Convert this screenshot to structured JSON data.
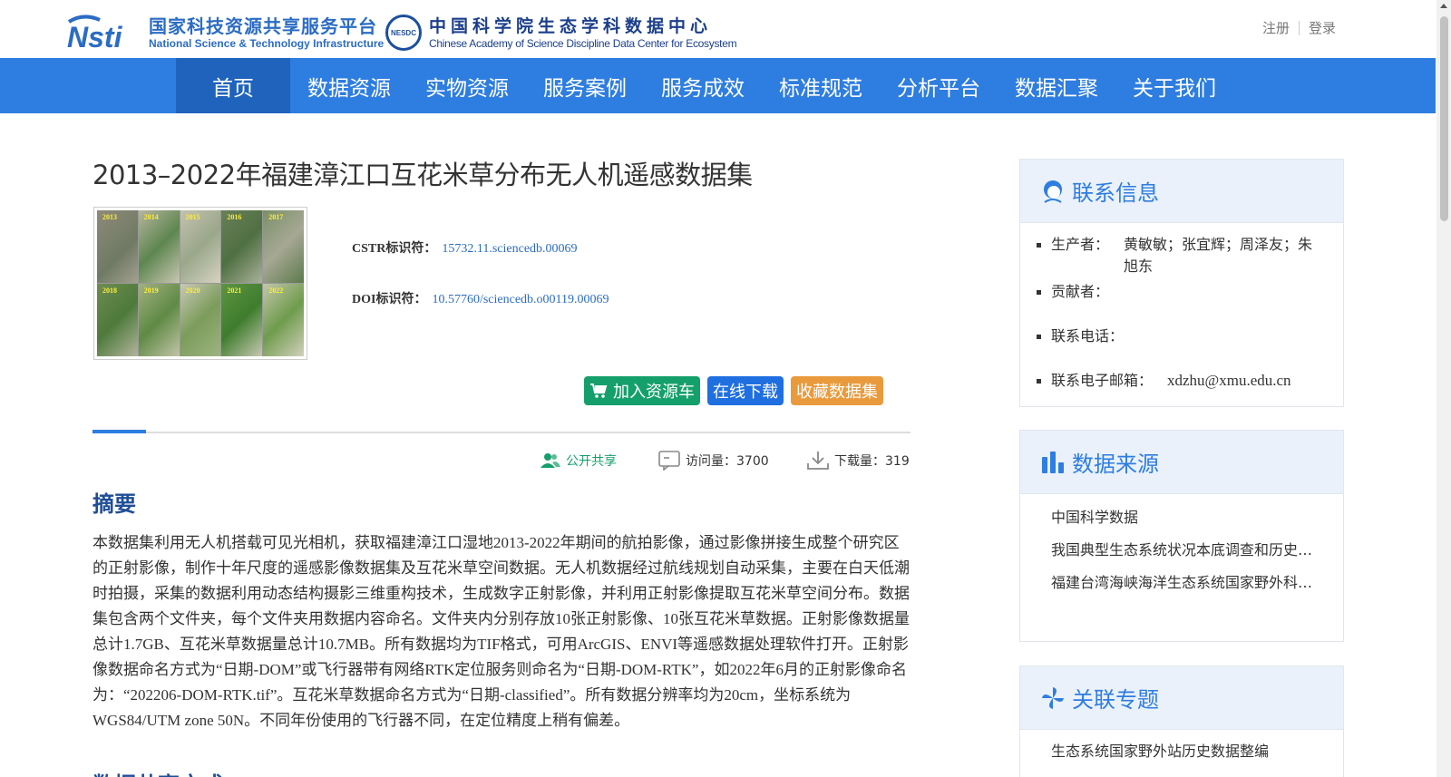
{
  "header": {
    "logo1_cn": "国家科技资源共享服务平台",
    "logo1_en": "National Science & Technology Infrastructure",
    "logo1_mark": "Nsti",
    "logo2_badge": "NESDC",
    "logo2_cn": "中国科学院生态学科数据中心",
    "logo2_en": "Chinese Academy of Science Discipline Data Center for Ecosystem",
    "register": "注册",
    "login": "登录"
  },
  "nav": {
    "items": [
      "首页",
      "数据资源",
      "实物资源",
      "服务案例",
      "服务成效",
      "标准规范",
      "分析平台",
      "数据汇聚",
      "关于我们"
    ],
    "active": "首页"
  },
  "dataset": {
    "title": "2013–2022年福建漳江口互花米草分布无人机遥感数据集",
    "thumb_years": [
      "2013",
      "2014",
      "2015",
      "2016",
      "2017",
      "2018",
      "2019",
      "2020",
      "2021",
      "2022"
    ],
    "cstr_label": "CSTR标识符：",
    "cstr_value": "15732.11.sciencedb.00069",
    "doi_label": "DOI标识符：",
    "doi_value": "10.57760/sciencedb.o00119.00069",
    "btn_cart": "加入资源车",
    "btn_download": "在线下载",
    "btn_favorite": "收藏数据集",
    "share": "公开共享",
    "visits": "访问量：3700",
    "downloads": "下载量：319",
    "abstract_title": "摘要",
    "abstract": "本数据集利用无人机搭载可见光相机，获取福建漳江口湿地2013-2022年期间的航拍影像，通过影像拼接生成整个研究区的正射影像，制作十年尺度的遥感影像数据集及互花米草空间数据。无人机数据经过航线规划自动采集，主要在白天低潮时拍摄，采集的数据利用动态结构摄影三维重构技术，生成数字正射影像，并利用正射影像提取互花米草空间分布。数据集包含两个文件夹，每个文件夹用数据内容命名。文件夹内分别存放10张正射影像、10张互花米草数据。正射影像数据量总计1.7GB、互花米草数据量总计10.7MB。所有数据均为TIF格式，可用ArcGIS、ENVI等遥感数据处理软件打开。正射影像数据命名方式为“日期-DOM”或飞行器带有网络RTK定位服务则命名为“日期-DOM-RTK”，如2022年6月的正射影像命名为：“202206-DOM-RTK.tif”。互花米草数据命名方式为“日期-classified”。所有数据分辨率均为20cm，坐标系统为WGS84/UTM zone 50N。不同年份使用的飞行器不同，在定位精度上稍有偏差。",
    "next_section": "数据共享方式"
  },
  "sidebar": {
    "contact_title": "联系信息",
    "producer_label": "生产者：",
    "producer_value": "黄敏敏；张宜辉；周泽友；朱旭东",
    "contributor_label": "贡献者：",
    "phone_label": "联系电话：",
    "email_label": "联系电子邮箱：",
    "email_value": "xdzhu@xmu.edu.cn",
    "source_title": "数据来源",
    "sources": [
      "中国科学数据",
      "我国典型生态系统状况本底调查和历史数据整编",
      "福建台湾海峡海洋生态系统国家野外科学观测研究站"
    ],
    "topic_title": "关联专题",
    "topics": [
      "生态系统国家野外站历史数据整编"
    ]
  },
  "colors": {
    "nav_bg": "#2e7de0",
    "nav_active": "#1f63bd",
    "btn_green": "#15a06b",
    "btn_blue": "#1f6fe0",
    "btn_orange": "#e99a3c",
    "link": "#2b6cc4",
    "heading": "#1f4e96"
  },
  "icons": {
    "cart": "cart-icon",
    "share": "users-icon",
    "visits": "comment-icon",
    "downloads": "download-icon",
    "contact": "person-icon",
    "source": "bar-chart-icon",
    "topic": "pinwheel-icon"
  }
}
